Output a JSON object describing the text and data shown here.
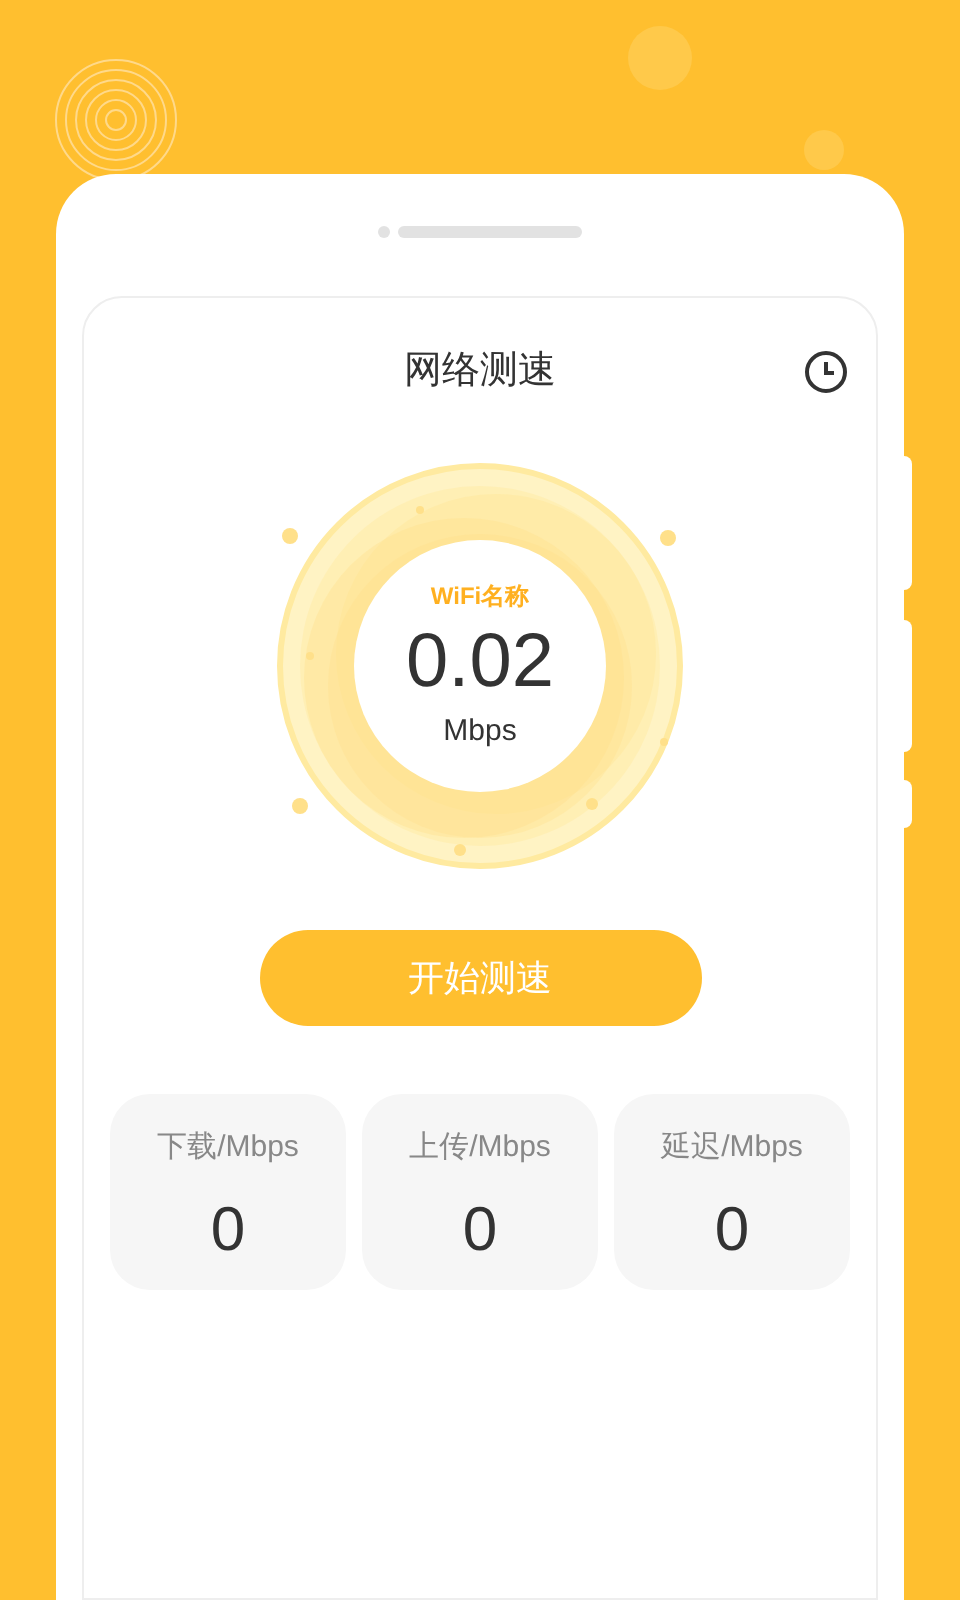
{
  "header": {
    "title": "网络测速"
  },
  "gauge": {
    "network_label": "WiFi名称",
    "speed": "0.02",
    "unit": "Mbps"
  },
  "start_button": {
    "label": "开始测速"
  },
  "stats": [
    {
      "label": "下载/Mbps",
      "value": "0"
    },
    {
      "label": "上传/Mbps",
      "value": "0"
    },
    {
      "label": "延迟/Mbps",
      "value": "0"
    }
  ]
}
